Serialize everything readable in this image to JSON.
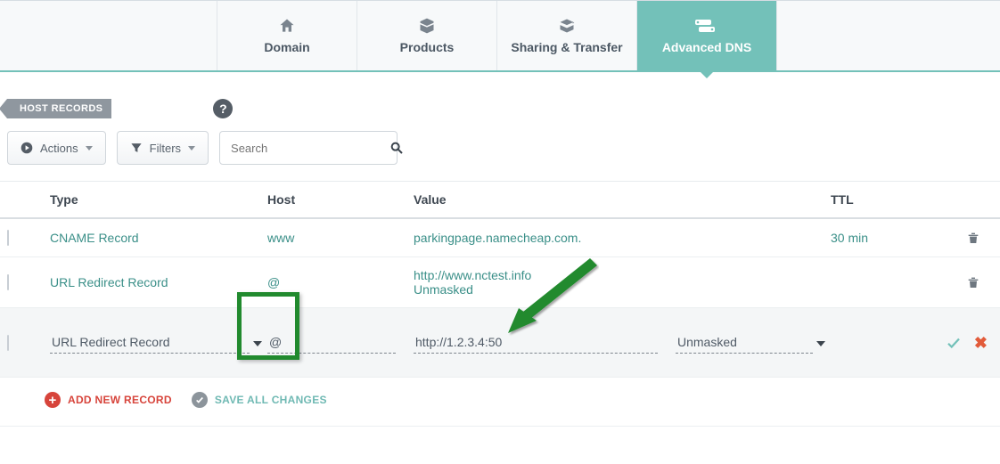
{
  "nav": {
    "tabs": [
      {
        "id": "domain",
        "label": "Domain"
      },
      {
        "id": "products",
        "label": "Products"
      },
      {
        "id": "sharing",
        "label": "Sharing & Transfer"
      },
      {
        "id": "advdns",
        "label": "Advanced DNS"
      }
    ],
    "active": "advdns"
  },
  "section": {
    "title": "HOST RECORDS",
    "help": "?"
  },
  "toolbar": {
    "actions_label": "Actions",
    "filters_label": "Filters",
    "search_placeholder": "Search"
  },
  "columns": {
    "type": "Type",
    "host": "Host",
    "value": "Value",
    "ttl": "TTL"
  },
  "records": [
    {
      "type": "CNAME Record",
      "host": "www",
      "value": "parkingpage.namecheap.com.",
      "value2": "",
      "ttl": "30 min"
    },
    {
      "type": "URL Redirect Record",
      "host": "@",
      "value": "http://www.nctest.info",
      "value2": "Unmasked",
      "ttl": ""
    }
  ],
  "editing": {
    "type": "URL Redirect Record",
    "host": "@",
    "value": "http://1.2.3.4:50",
    "mask": "Unmasked"
  },
  "footer": {
    "add_label": "ADD NEW RECORD",
    "save_label": "SAVE ALL CHANGES"
  }
}
